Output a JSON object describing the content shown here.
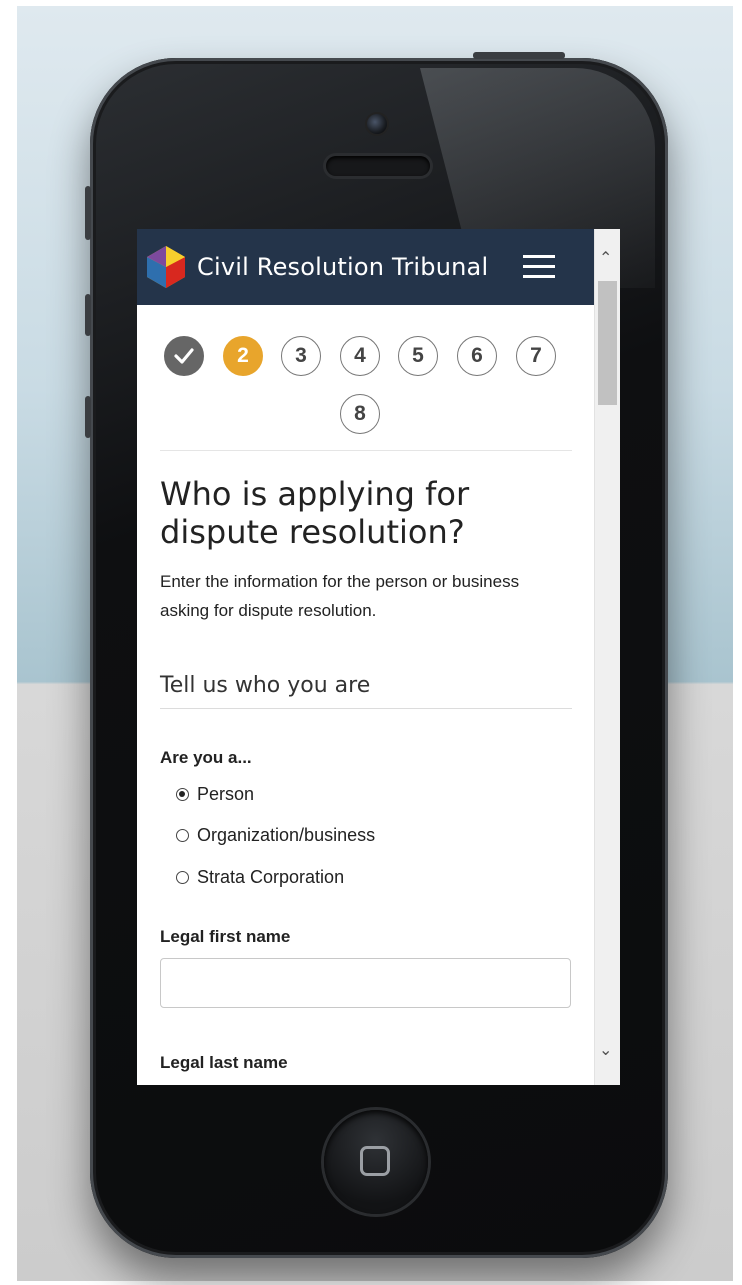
{
  "header": {
    "brand": "Civil Resolution Tribunal",
    "menu_icon": "hamburger-menu-icon",
    "logo_icon": "hexagon-logo-icon"
  },
  "stepper": {
    "steps": [
      {
        "label": "",
        "state": "done"
      },
      {
        "label": "2",
        "state": "current"
      },
      {
        "label": "3",
        "state": "upcoming"
      },
      {
        "label": "4",
        "state": "upcoming"
      },
      {
        "label": "5",
        "state": "upcoming"
      },
      {
        "label": "6",
        "state": "upcoming"
      },
      {
        "label": "7",
        "state": "upcoming"
      },
      {
        "label": "8",
        "state": "upcoming"
      }
    ]
  },
  "page": {
    "title": "Who is applying for dispute resolution?",
    "intro": "Enter the information for the person or business asking for dispute resolution.",
    "section_title": "Tell us who you are"
  },
  "form": {
    "applicant_type": {
      "label": "Are you a...",
      "options": [
        "Person",
        "Organization/business",
        "Strata Corporation"
      ],
      "selected": "Person"
    },
    "first_name": {
      "label": "Legal first name",
      "value": "",
      "placeholder": ""
    },
    "last_name": {
      "label": "Legal last name"
    }
  },
  "colors": {
    "navbar": "#24344a",
    "step_current": "#e8a52c",
    "step_done": "#666666"
  }
}
